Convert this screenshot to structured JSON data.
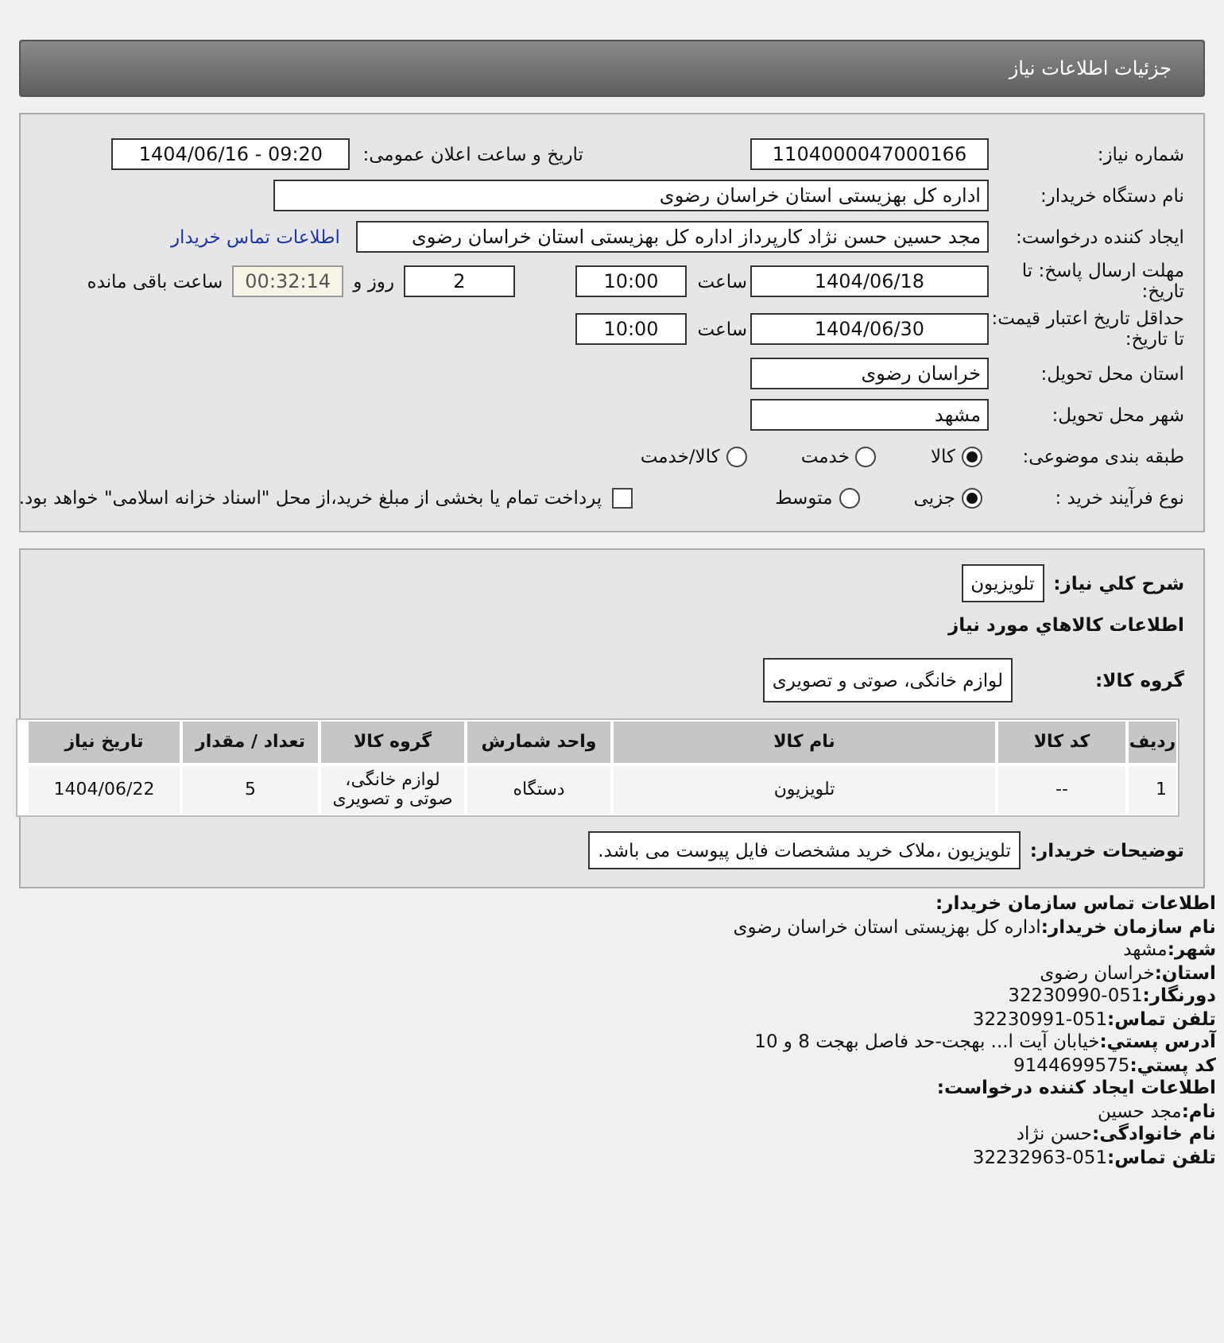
{
  "page_title": "جزئیات اطلاعات نیاز",
  "need_number": {
    "label": "شماره نیاز:",
    "value": "1104000047000166"
  },
  "announce": {
    "label": "تاریخ و ساعت اعلان عمومی:",
    "value": "1404/06/16 - 09:20"
  },
  "buyer_org": {
    "label": "نام دستگاه خریدار:",
    "value": "اداره کل بهزیستی استان خراسان رضوی"
  },
  "requester": {
    "label": "ایجاد کننده درخواست:",
    "value": "مجد حسین حسن نژاد کارپرداز اداره کل بهزیستی استان خراسان رضوی",
    "link": "اطلاعات تماس خریدار"
  },
  "deadline": {
    "label": "مهلت ارسال پاسخ: تا تاریخ:",
    "date": "1404/06/18",
    "time_label": "ساعت",
    "time": "10:00",
    "days": "2",
    "days_label": "روز و",
    "remaining": "00:32:14",
    "remaining_label": "ساعت باقی مانده"
  },
  "validity": {
    "label": "حداقل تاریخ اعتبار قیمت: تا تاریخ:",
    "date": "1404/06/30",
    "time_label": "ساعت",
    "time": "10:00"
  },
  "province": {
    "label": "استان محل تحویل:",
    "value": "خراسان رضوی"
  },
  "city": {
    "label": "شهر محل تحویل:",
    "value": "مشهد"
  },
  "category": {
    "label": "طبقه بندی موضوعی:",
    "options": [
      {
        "label": "کالا",
        "selected": true
      },
      {
        "label": "خدمت",
        "selected": false
      },
      {
        "label": "کالا/خدمت",
        "selected": false
      }
    ]
  },
  "process": {
    "label": "نوع فرآیند خرید :",
    "options": [
      {
        "label": "جزیی",
        "selected": true
      },
      {
        "label": "متوسط",
        "selected": false
      }
    ],
    "payment": {
      "label": "پرداخت تمام یا بخشی از مبلغ خرید،از محل \"اسناد خزانه اسلامی\" خواهد بود.",
      "checked": false
    }
  },
  "summary": {
    "label": "شرح کلي نیاز:",
    "value": "تلویزیون"
  },
  "goods_title": "اطلاعات کالاهاي مورد نیاز",
  "goods_group": {
    "label": "گروه کالا:",
    "value": "لوازم خانگی، صوتی و تصویری"
  },
  "table": {
    "columns": [
      "ردیف",
      "کد کالا",
      "نام کالا",
      "واحد شمارش",
      "گروه کالا",
      "تعداد / مقدار",
      "تاریخ نیاز"
    ],
    "rows": [
      [
        "1",
        "--",
        "تلویزیون",
        "دستگاه",
        "لوازم خانگی، صوتی و تصویری",
        "5",
        "1404/06/22"
      ]
    ]
  },
  "buyer_notes": {
    "label": "توضیحات خریدار:",
    "value": "تلویزیون ،ملاک خرید مشخصات فایل پیوست می باشد."
  },
  "contact": [
    {
      "label": "اطلاعات تماس سازمان خریدار:"
    },
    {
      "label": "نام سازمان خریدار:",
      "value": "اداره کل بهزیستی استان خراسان رضوی"
    },
    {
      "label": "شهر:",
      "value": "مشهد"
    },
    {
      "label": "استان:",
      "value": "خراسان رضوی"
    },
    {
      "label": "دورنگار:",
      "value": "32230990-051"
    },
    {
      "label": "تلفن تماس:",
      "value": "32230991-051"
    },
    {
      "label": "آدرس پستي:",
      "value": "خیابان آیت ا... بهجت-حد فاصل بهجت 8 و 10"
    },
    {
      "label": "کد پستي:",
      "value": "9144699575"
    },
    {
      "label": "اطلاعات ایجاد کننده درخواست:"
    },
    {
      "label": "نام:",
      "value": "مجد حسین"
    },
    {
      "label": "نام خانوادگی:",
      "value": "حسن نژاد"
    },
    {
      "label": "تلفن تماس:",
      "value": "32232963-051"
    }
  ]
}
